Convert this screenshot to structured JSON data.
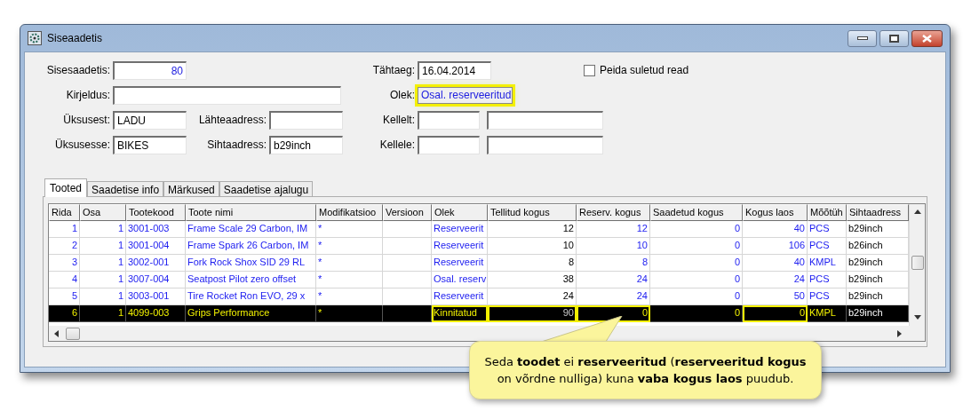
{
  "window": {
    "title": "Siseaadetis"
  },
  "form": {
    "left": [
      {
        "kind": "number",
        "label": "Sisesaadetis:",
        "value": "80"
      },
      {
        "kind": "wide",
        "label": "Kirjeldus:"
      },
      {
        "kind": "text",
        "label": "Üksusest:",
        "value": "LADU"
      },
      {
        "kind": "text",
        "label": "Üksusesse:",
        "value": "BIKES"
      }
    ],
    "middle": [
      {
        "kind": "text",
        "label": "Lähteaadress:"
      },
      {
        "kind": "text",
        "label": "Sihtaadress:",
        "value": "b29inch"
      }
    ],
    "right": [
      {
        "kind": "text",
        "label": "Tähtaeg:",
        "value": "16.04.2014"
      },
      {
        "kind": "status",
        "label": "Olek:",
        "value": "Osal. reserveeritud",
        "highlighted": true
      },
      {
        "kind": "pair",
        "label": "Kellelt:"
      },
      {
        "kind": "pair",
        "label": "Kellele:"
      }
    ],
    "checkbox": {
      "label": "Peida suletud read",
      "checked": false
    }
  },
  "tabs": [
    {
      "label": "Tooted",
      "selected": true
    },
    {
      "label": "Saadetise info",
      "selected": false
    },
    {
      "label": "Märkused",
      "selected": false
    },
    {
      "label": "Saadetise ajalugu",
      "selected": false
    }
  ],
  "table": {
    "columns": [
      {
        "label": "Rida",
        "kind": "number",
        "blue": true
      },
      {
        "label": "Osa",
        "kind": "number",
        "blue": true
      },
      {
        "label": "Tootekood",
        "kind": "text",
        "blue": true
      },
      {
        "label": "Toote nimi",
        "kind": "text",
        "blue": true
      },
      {
        "label": "Modifikatsioo",
        "kind": "text",
        "blue": true
      },
      {
        "label": "Versioon",
        "kind": "text"
      },
      {
        "label": "Olek",
        "kind": "text",
        "blue": true
      },
      {
        "label": "Tellitud kogus",
        "kind": "number",
        "blue": false
      },
      {
        "label": "Reserv. kogus",
        "kind": "number",
        "blue": true
      },
      {
        "label": "Saadetud kogus",
        "kind": "number",
        "blue": true
      },
      {
        "label": "Kogus laos",
        "kind": "number",
        "blue": true
      },
      {
        "label": "Mõõtüh",
        "kind": "text",
        "blue": true
      },
      {
        "label": "Sihtaadress",
        "kind": "text",
        "blue": false
      }
    ],
    "rows": [
      {
        "selected": false,
        "cells": [
          "1",
          "1",
          "3001-003",
          "Frame Scale 29 Carbon, IM",
          "*",
          null,
          "Reserveerit",
          "12",
          "12",
          "0",
          "40",
          "PCS",
          "b29inch"
        ]
      },
      {
        "selected": false,
        "cells": [
          "2",
          "1",
          "3001-004",
          "Frame Spark 26 Carbon, IM",
          "*",
          null,
          "Reserveerit",
          "10",
          "10",
          "0",
          "106",
          "PCS",
          "b26inch"
        ]
      },
      {
        "selected": false,
        "cells": [
          "3",
          "1",
          "3002-001",
          "Fork Rock Shox SID 29 RL",
          "*",
          null,
          "Reserveerit",
          "8",
          "8",
          "0",
          "40",
          "KMPL",
          "b29inch"
        ]
      },
      {
        "selected": false,
        "cells": [
          "4",
          "1",
          "3007-004",
          "Seatpost Pilot zero offset",
          "*",
          null,
          "Osal. reserv",
          "38",
          "24",
          "0",
          "24",
          "PCS",
          "b29inch"
        ]
      },
      {
        "selected": false,
        "cells": [
          "5",
          "1",
          "3003-001",
          "Tire Rocket Ron EVO, 29 x",
          "*",
          null,
          "Reserveerit",
          "24",
          "24",
          "0",
          "50",
          "PCS",
          "b29inch"
        ]
      },
      {
        "selected": true,
        "highlights": [
          false,
          false,
          false,
          false,
          false,
          false,
          true,
          true,
          true,
          false,
          true,
          false,
          false
        ],
        "cells": [
          "6",
          "1",
          "4099-003",
          "Grips Performance",
          "*",
          null,
          "Kinnitatud",
          "90",
          "0",
          "0",
          "0",
          "KMPL",
          "b29inch"
        ]
      }
    ]
  },
  "callout": {
    "text": "Seda **toodet** ei **reserveeritud** (**reserveeritud kogus** on võrdne nulliga) kuna **vaba kogus laos** puudub."
  }
}
